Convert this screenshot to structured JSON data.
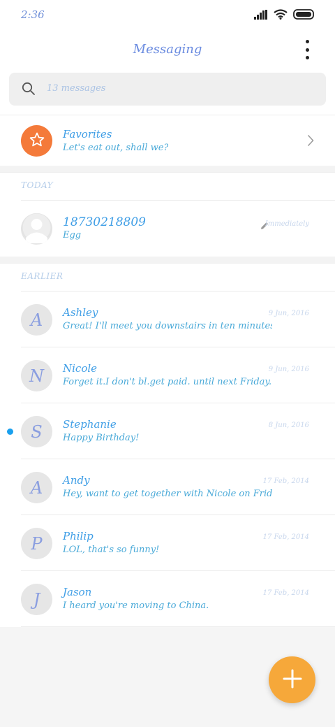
{
  "status_bar": {
    "time": "2:36"
  },
  "header": {
    "title": "Messaging",
    "menu_icon": "more-vertical-icon"
  },
  "search": {
    "placeholder": "13 messages",
    "icon": "search-icon"
  },
  "favorites": {
    "title": "Favorites",
    "preview": "Let's eat out, shall we?",
    "icon": "star-icon",
    "accent": "#f47a3a"
  },
  "sections": {
    "today": "TODAY",
    "earlier": "EARLIER"
  },
  "today_item": {
    "title": "18730218809",
    "preview": "Egg",
    "time": "Immediately",
    "draft_icon": "pencil-icon"
  },
  "messages": [
    {
      "name": "Ashley",
      "initial": "A",
      "preview": "Great! I'll meet you downstairs in ten minutes. Don'···",
      "date": "9 Jun, 2016",
      "unread": false
    },
    {
      "name": "Nicole",
      "initial": "N",
      "preview": "Forget it.I don't bl.get paid. until next Friday.",
      "date": "9 Jun, 2016",
      "unread": false
    },
    {
      "name": "Stephanie",
      "initial": "S",
      "preview": "Happy Birthday!",
      "date": "8 Jun, 2016",
      "unread": true
    },
    {
      "name": "Andy",
      "initial": "A",
      "preview": "Hey, want to get together with Nicole on Friday?",
      "date": "17 Feb, 2014",
      "unread": false
    },
    {
      "name": "Philip",
      "initial": "P",
      "preview": "LOL, that's so funny!",
      "date": "17 Feb, 2014",
      "unread": false
    },
    {
      "name": "Jason",
      "initial": "J",
      "preview": "I heard you're moving to China.",
      "date": "17 Feb, 2014",
      "unread": false
    }
  ],
  "fab": {
    "icon": "plus-icon",
    "color": "#f6a83a"
  },
  "colors": {
    "title_blue": "#3f9ee6",
    "unread_dot": "#1aa0ee",
    "avatar_bg": "#e6e6e6"
  }
}
